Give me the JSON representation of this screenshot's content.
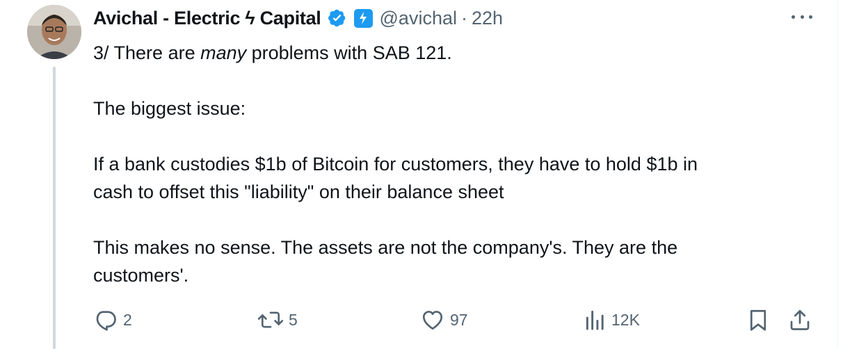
{
  "author": {
    "display_name": "Avichal - Electric ϟ Capital",
    "handle": "@avichal",
    "separator": "·",
    "time": "22h",
    "avatar_icon": "profile-photo",
    "verified_icon": "verified-badge-icon",
    "affiliation_icon": "electric-capital-affiliate-badge",
    "accent_color": "#1d9bf0"
  },
  "tweet": {
    "intro_prefix": "3/ There are ",
    "intro_emphasis": "many",
    "intro_suffix": " problems with SAB 121.",
    "para2": "The biggest issue:",
    "para3_line1": "If a bank custodies $1b of Bitcoin for customers, they have to hold $1b in",
    "para3_line2": "cash to offset this \"liability\" on their balance sheet",
    "para4_line1": "This makes no sense. The assets are not the company's. They are the",
    "para4_line2": "customers'."
  },
  "actions": {
    "replies": "2",
    "reposts": "5",
    "likes": "97",
    "views": "12K",
    "reply_icon": "reply-icon",
    "repost_icon": "repost-icon",
    "like_icon": "heart-icon",
    "views_icon": "views-icon",
    "bookmark_icon": "bookmark-icon",
    "share_icon": "share-icon"
  },
  "colors": {
    "text": "#0f1419",
    "secondary": "#536471",
    "thread_line": "#cfd9de"
  }
}
